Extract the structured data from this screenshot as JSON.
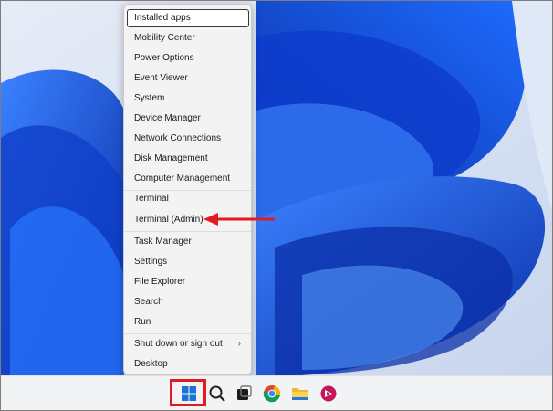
{
  "menu": {
    "items": [
      {
        "label": "Installed apps",
        "selected": true
      },
      {
        "label": "Mobility Center"
      },
      {
        "label": "Power Options"
      },
      {
        "label": "Event Viewer"
      },
      {
        "label": "System"
      },
      {
        "label": "Device Manager"
      },
      {
        "label": "Network Connections"
      },
      {
        "label": "Disk Management"
      },
      {
        "label": "Computer Management"
      },
      {
        "label": "Terminal"
      },
      {
        "label": "Terminal (Admin)",
        "annotated": true
      },
      {
        "label": "Task Manager"
      },
      {
        "label": "Settings"
      },
      {
        "label": "File Explorer"
      },
      {
        "label": "Search"
      },
      {
        "label": "Run"
      },
      {
        "label": "Shut down or sign out",
        "has_submenu": true
      },
      {
        "label": "Desktop"
      }
    ],
    "submenu_chevron": "›"
  },
  "taskbar": {
    "icons": [
      "start-icon",
      "search-icon",
      "task-view-icon",
      "chrome-icon",
      "file-explorer-icon",
      "app-icon"
    ]
  },
  "colors": {
    "annotation": "#e01b22",
    "wallpaper_blue": "#1653e0"
  }
}
